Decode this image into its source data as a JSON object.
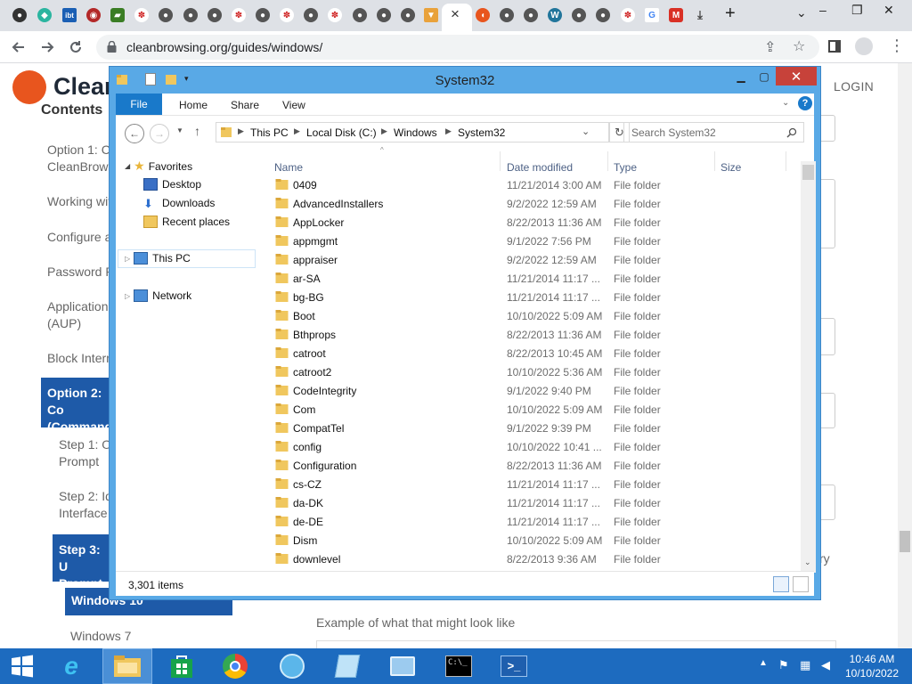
{
  "chrome": {
    "active_tab_close": "×",
    "new_tab": "+",
    "url": "cleanbrowsing.org/guides/windows/",
    "win_controls": [
      "⌄",
      "–",
      "❐",
      "✕"
    ]
  },
  "web": {
    "logo_text": "Clean",
    "login": "LOGIN",
    "toc_title": "Contents",
    "sidebar": [
      "Option 1: Co",
      "CleanBrows",
      "Working wit",
      "Configure a",
      "Password P",
      "Application",
      "(AUP)",
      "Block Intern"
    ],
    "active_option": [
      "Option 2: Co",
      "(Command"
    ],
    "steps": [
      "Step 1: O",
      "Prompt",
      "Step 2: Id",
      "Interface"
    ],
    "active_step": [
      "Step 3: U",
      "Prompt"
    ],
    "windows10": "Windows 10",
    "windows7": "Windows 7",
    "example_text": "Example of what that might look like",
    "right_fragment": "ry"
  },
  "explorer": {
    "title": "System32",
    "ribbon": {
      "file": "File",
      "home": "Home",
      "share": "Share",
      "view": "View"
    },
    "breadcrumb": [
      "This PC",
      "Local Disk (C:)",
      "Windows",
      "System32"
    ],
    "search_placeholder": "Search System32",
    "nav": {
      "favorites": "Favorites",
      "desktop": "Desktop",
      "downloads": "Downloads",
      "recent": "Recent places",
      "this_pc": "This PC",
      "network": "Network"
    },
    "columns": {
      "name": "Name",
      "date": "Date modified",
      "type": "Type",
      "size": "Size"
    },
    "files": [
      {
        "name": "0409",
        "date": "11/21/2014 3:00 AM",
        "type": "File folder"
      },
      {
        "name": "AdvancedInstallers",
        "date": "9/2/2022 12:59 AM",
        "type": "File folder"
      },
      {
        "name": "AppLocker",
        "date": "8/22/2013 11:36 AM",
        "type": "File folder"
      },
      {
        "name": "appmgmt",
        "date": "9/1/2022 7:56 PM",
        "type": "File folder"
      },
      {
        "name": "appraiser",
        "date": "9/2/2022 12:59 AM",
        "type": "File folder"
      },
      {
        "name": "ar-SA",
        "date": "11/21/2014 11:17 ...",
        "type": "File folder"
      },
      {
        "name": "bg-BG",
        "date": "11/21/2014 11:17 ...",
        "type": "File folder"
      },
      {
        "name": "Boot",
        "date": "10/10/2022 5:09 AM",
        "type": "File folder"
      },
      {
        "name": "Bthprops",
        "date": "8/22/2013 11:36 AM",
        "type": "File folder"
      },
      {
        "name": "catroot",
        "date": "8/22/2013 10:45 AM",
        "type": "File folder"
      },
      {
        "name": "catroot2",
        "date": "10/10/2022 5:36 AM",
        "type": "File folder"
      },
      {
        "name": "CodeIntegrity",
        "date": "9/1/2022 9:40 PM",
        "type": "File folder"
      },
      {
        "name": "Com",
        "date": "10/10/2022 5:09 AM",
        "type": "File folder"
      },
      {
        "name": "CompatTel",
        "date": "9/1/2022 9:39 PM",
        "type": "File folder"
      },
      {
        "name": "config",
        "date": "10/10/2022 10:41 ...",
        "type": "File folder"
      },
      {
        "name": "Configuration",
        "date": "8/22/2013 11:36 AM",
        "type": "File folder"
      },
      {
        "name": "cs-CZ",
        "date": "11/21/2014 11:17 ...",
        "type": "File folder"
      },
      {
        "name": "da-DK",
        "date": "11/21/2014 11:17 ...",
        "type": "File folder"
      },
      {
        "name": "de-DE",
        "date": "11/21/2014 11:17 ...",
        "type": "File folder"
      },
      {
        "name": "Dism",
        "date": "10/10/2022 5:09 AM",
        "type": "File folder"
      },
      {
        "name": "downlevel",
        "date": "8/22/2013 9:36 AM",
        "type": "File folder"
      }
    ],
    "status": "3,301 items"
  },
  "taskbar": {
    "time": "10:46 AM",
    "date": "10/10/2022"
  }
}
